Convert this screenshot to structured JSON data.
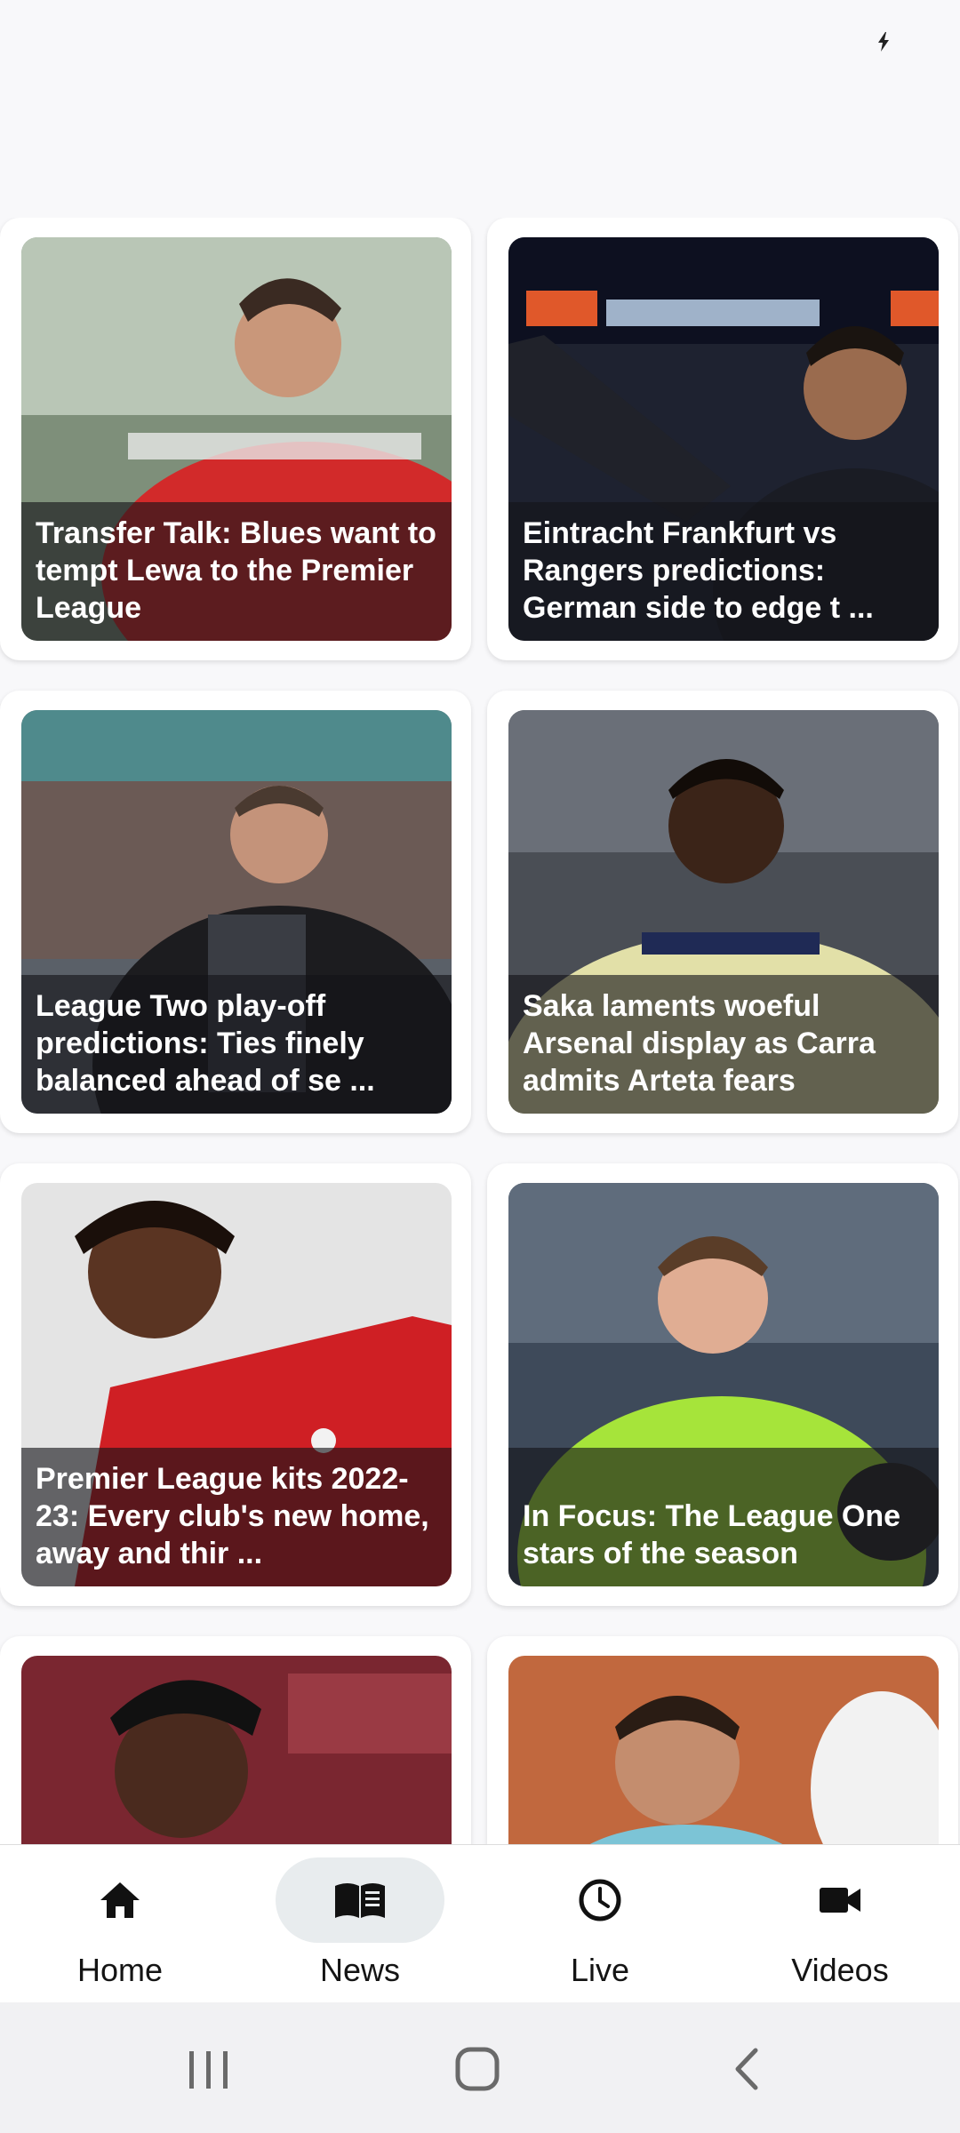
{
  "status_bar": {
    "icons": [
      "charging-bolt-icon"
    ]
  },
  "articles": [
    {
      "title": "Transfer Talk: Blues want to tempt Lewa to the Premier League",
      "image": "player-red-kit"
    },
    {
      "title": "Eintracht Frankfurt vs Rangers predictions: German side to edge t ...",
      "image": "manager-waving"
    },
    {
      "title": "League Two play-off predictions: Ties finely balanced ahead of se ...",
      "image": "manager-dark-jacket"
    },
    {
      "title": "Saka laments woeful Arsenal display as Carra admits Arteta fears",
      "image": "player-yellow-kit"
    },
    {
      "title": "Premier League kits 2022-23: Every club's new home, away and thir ...",
      "image": "player-red-liverpool-kit"
    },
    {
      "title": "In Focus: The League One stars of the season",
      "image": "goalkeeper-green-kit"
    },
    {
      "title": "",
      "image": "player-smiling-cap"
    },
    {
      "title": "",
      "image": "tennis-player"
    }
  ],
  "bottom_nav": {
    "items": [
      {
        "label": "Home",
        "icon": "home-icon",
        "active": false
      },
      {
        "label": "News",
        "icon": "newspaper-icon",
        "active": true
      },
      {
        "label": "Live",
        "icon": "clock-icon",
        "active": false
      },
      {
        "label": "Videos",
        "icon": "videocam-icon",
        "active": false
      }
    ]
  },
  "system_nav": {
    "buttons": [
      "recents-button",
      "home-button",
      "back-button"
    ]
  },
  "colors": {
    "caption_overlay": "#14141a",
    "nav_active_pill": "#e8ecee",
    "background": "#f8f8fa"
  }
}
